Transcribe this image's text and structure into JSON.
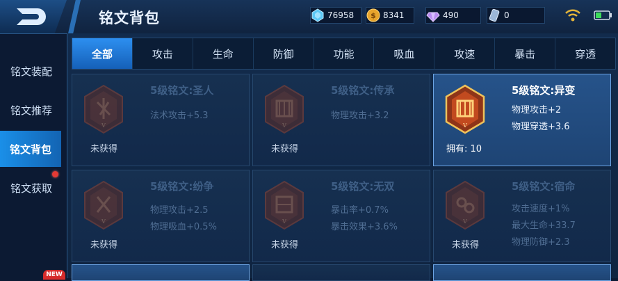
{
  "header": {
    "title": "铭文背包",
    "currencies": [
      {
        "icon": "diamond-icon",
        "value": "76958"
      },
      {
        "icon": "gold-coin-icon",
        "value": "8341"
      },
      {
        "icon": "gem-icon",
        "value": "490"
      },
      {
        "icon": "voucher-icon",
        "value": "0"
      }
    ]
  },
  "sidebar": {
    "items": [
      {
        "label": "铭文装配"
      },
      {
        "label": "铭文推荐"
      },
      {
        "label": "铭文背包"
      },
      {
        "label": "铭文获取"
      }
    ],
    "new_badge": "NEW"
  },
  "tabs": [
    "全部",
    "攻击",
    "生命",
    "防御",
    "功能",
    "吸血",
    "攻速",
    "暴击",
    "穿透"
  ],
  "cards": [
    {
      "name": "5级铭文:圣人",
      "stats": [
        "法术攻击+5.3"
      ],
      "status": "未获得"
    },
    {
      "name": "5级铭文:传承",
      "stats": [
        "物理攻击+3.2"
      ],
      "status": "未获得"
    },
    {
      "name": "5级铭文:异变",
      "stats": [
        "物理攻击+2",
        "物理穿透+3.6"
      ],
      "status": "拥有: 10"
    },
    {
      "name": "5级铭文:纷争",
      "stats": [
        "物理攻击+2.5",
        "物理吸血+0.5%"
      ],
      "status": "未获得"
    },
    {
      "name": "5级铭文:无双",
      "stats": [
        "暴击率+0.7%",
        "暴击效果+3.6%"
      ],
      "status": "未获得"
    },
    {
      "name": "5级铭文:宿命",
      "stats": [
        "攻击速度+1%",
        "最大生命+33.7",
        "物理防御+2.3"
      ],
      "status": "未获得"
    }
  ],
  "colors": {
    "accent": "#1a8fe8",
    "emblem_red": "#b0492b",
    "emblem_gold": "#d9a441"
  }
}
